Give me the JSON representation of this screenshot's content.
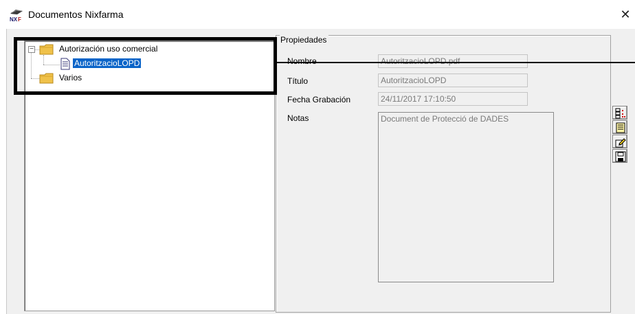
{
  "window": {
    "title": "Documentos Nixfarma",
    "close_glyph": "✕",
    "app_icon": "nixfarma-logo-icon"
  },
  "tree": {
    "nodes": [
      {
        "label": "Autorización uso comercial",
        "icon": "folder-icon",
        "expanded": true,
        "expander": "−"
      },
      {
        "label": "AutoritzacioLOPD",
        "icon": "document-icon",
        "selected": true
      },
      {
        "label": "Varios",
        "icon": "folder-icon"
      }
    ]
  },
  "properties": {
    "group_title": "Propiedades",
    "fields": [
      {
        "label": "Nombre",
        "value": "AutoritzacioLOPD.pdf"
      },
      {
        "label": "Título",
        "value": "AutoritzacioLOPD"
      },
      {
        "label": "Fecha Grabación",
        "value": "24/11/2017 17:10:50"
      }
    ],
    "notes_label": "Notas",
    "notes_value": "Document de Protecció de DADES"
  },
  "toolbar": {
    "buttons": [
      {
        "icon": "list-properties-icon"
      },
      {
        "icon": "edit-notes-icon"
      },
      {
        "icon": "edit-pencil-icon"
      },
      {
        "icon": "save-icon"
      }
    ]
  },
  "colors": {
    "selection": "#0a64c8",
    "folder": "#f0c24a",
    "window_bg": "#f0f0f0"
  }
}
